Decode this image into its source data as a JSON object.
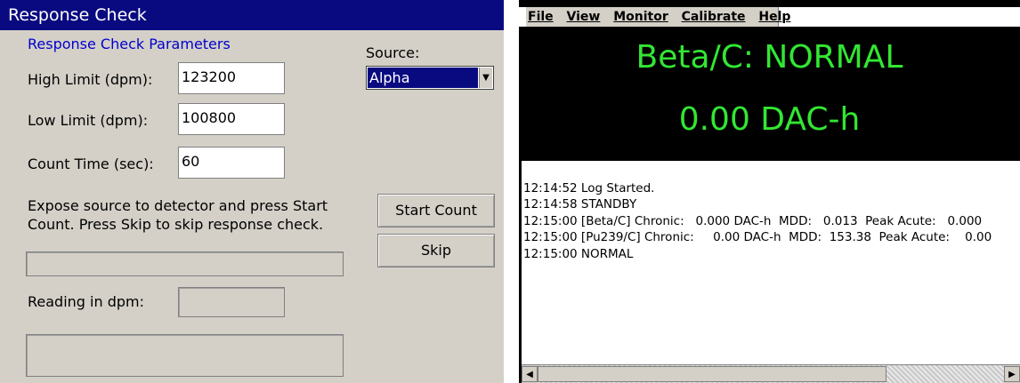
{
  "dialog": {
    "title": "Response Check",
    "group_title": "Response Check Parameters",
    "high_limit_label": "High Limit (dpm):",
    "high_limit_value": "123200",
    "low_limit_label": "Low Limit (dpm):",
    "low_limit_value": "100800",
    "count_time_label": "Count Time (sec):",
    "count_time_value": "60",
    "source_label": "Source:",
    "source_value": "Alpha",
    "instructions_line1": "Expose source to detector and press Start",
    "instructions_line2": "Count.  Press Skip to skip response check.",
    "start_count_label": "Start Count",
    "skip_label": "Skip",
    "reading_label": "Reading in dpm:",
    "reading_value": ""
  },
  "monitor": {
    "menu": [
      "File",
      "View",
      "Monitor",
      "Calibrate",
      "Help"
    ],
    "status": "Beta/C: NORMAL",
    "dose": "0.00 DAC-h",
    "status_color": "#33e633",
    "log": [
      "12:14:52 Log Started.",
      "12:14:58 STANDBY",
      "12:15:00 [Beta/C] Chronic:   0.000 DAC-h  MDD:   0.013  Peak Acute:   0.000",
      "12:15:00 [Pu239/C] Chronic:     0.00 DAC-h  MDD:  153.38  Peak Acute:    0.00",
      "12:15:00 NORMAL"
    ],
    "scroll_left_icon": "left-arrow-icon",
    "scroll_right_icon": "right-arrow-icon"
  }
}
